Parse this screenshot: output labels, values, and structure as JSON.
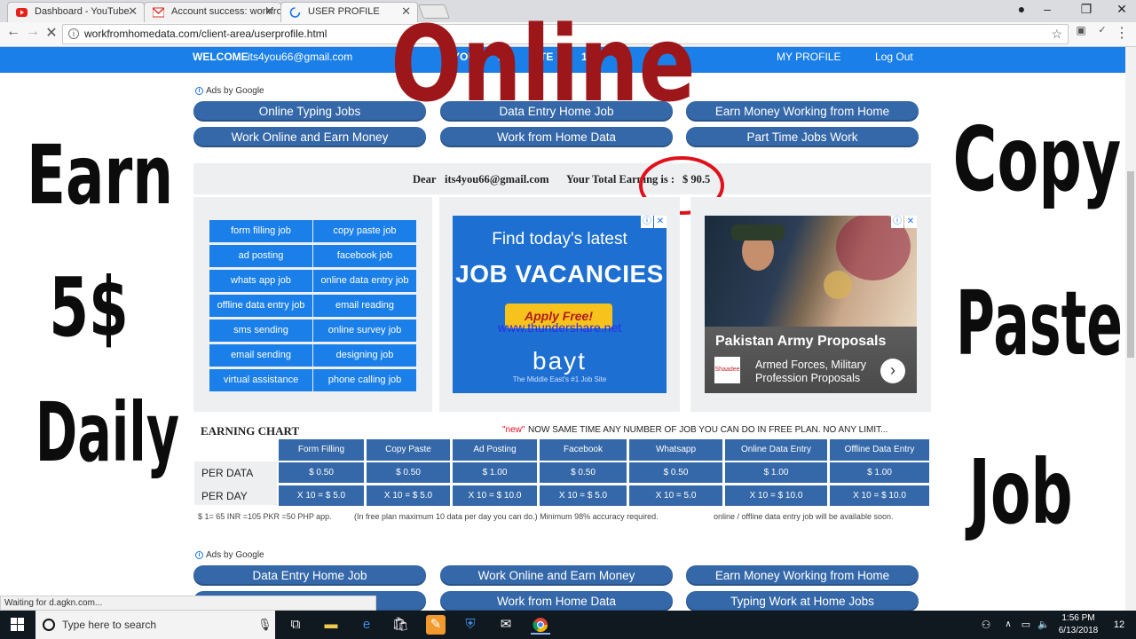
{
  "browser": {
    "tabs": [
      {
        "title": "Dashboard - YouTube",
        "icon": "youtube-icon"
      },
      {
        "title": "Account success: workfro",
        "icon": "gmail-icon"
      },
      {
        "title": "USER PROFILE",
        "icon": "loading-icon"
      }
    ],
    "url": "workfromhomedata.com/client-area/userprofile.html",
    "status": "Waiting for d.agkn.com..."
  },
  "navbar": {
    "welcome": "WELCOME",
    "email": "its4you66@gmail.com",
    "partial": "YOU",
    "partial2": "NI",
    "partial3": "TE",
    "partial4": "18",
    "my_profile": "MY PROFILE",
    "logout": "Log Out"
  },
  "ads_label": "Ads by Google",
  "top_links": [
    "Online Typing Jobs",
    "Data Entry Home Job",
    "Earn Money Working from Home",
    "Work Online and Earn Money",
    "Work from Home Data",
    "Part Time Jobs Work"
  ],
  "dear": {
    "dear_label": "Dear",
    "email": "its4you66@gmail.com",
    "earning_label": "Your Total Earning is :",
    "earning_value": "$ 90.5"
  },
  "jobs": [
    "form filling job",
    "copy paste job",
    "ad posting",
    "facebook job",
    "whats app job",
    "online data entry job",
    "offline data entry job",
    "email reading",
    "sms sending",
    "online survey job",
    "email sending",
    "designing job",
    "virtual assistance",
    "phone calling job"
  ],
  "ad1": {
    "line1": "Find today's latest",
    "line2": "JOB VACANCIES",
    "apply": "Apply Free!",
    "watermark": "www.thundershare.net",
    "brand": "bayt",
    "tagline": "The Middle East's #1 Job Site"
  },
  "ad2": {
    "title": "Pakistan Army Proposals",
    "logo": "Shaadee",
    "subtitle": "Armed Forces, Military Profession Proposals"
  },
  "earning_chart": {
    "title": "EARNING CHART",
    "new_tag": "\"new\"",
    "notice": "NOW SAME TIME ANY NUMBER OF JOB YOU CAN DO IN FREE PLAN. NO ANY LIMIT...",
    "columns": [
      "Form Filling",
      "Copy Paste",
      "Ad Posting",
      "Facebook",
      "Whatsapp",
      "Online Data Entry",
      "Offline Data Entry"
    ],
    "rows": [
      {
        "label": "PER DATA",
        "values": [
          "$ 0.50",
          "$ 0.50",
          "$ 1.00",
          "$ 0.50",
          "$ 0.50",
          "$ 1.00",
          "$ 1.00"
        ]
      },
      {
        "label": "PER DAY",
        "values": [
          "X 10 = $ 5.0",
          "X 10 = $ 5.0",
          "X 10 = $ 10.0",
          "X 10 = $ 5.0",
          "X 10 = 5.0",
          "X 10 = $ 10.0",
          "X 10 = $ 10.0"
        ]
      }
    ],
    "footnotes": [
      "$ 1= 65 INR =105 PKR =50 PHP app.",
      "(In free plan maximum 10 data per day you can do.) Minimum 98% accuracy required.",
      "online / offline data entry job will be available soon."
    ]
  },
  "bottom_links": [
    "Data Entry Home Job",
    "Work Online and Earn Money",
    "Earn Money Working from Home",
    "",
    "Work from Home Data",
    "Typing Work at Home Jobs"
  ],
  "overlay": {
    "online": "Online",
    "left": [
      "Earn",
      "5$",
      "Daily"
    ],
    "right": [
      "Copy",
      "Paste",
      "Job"
    ]
  },
  "taskbar": {
    "search_placeholder": "Type here to search",
    "time": "1:56 PM",
    "date": "6/13/2018",
    "notification_count": "12"
  },
  "colors": {
    "nav_blue": "#1a7fe8",
    "pill_blue": "#3568a9",
    "online_red": "#9d161a",
    "circle_red": "#e0101c"
  }
}
